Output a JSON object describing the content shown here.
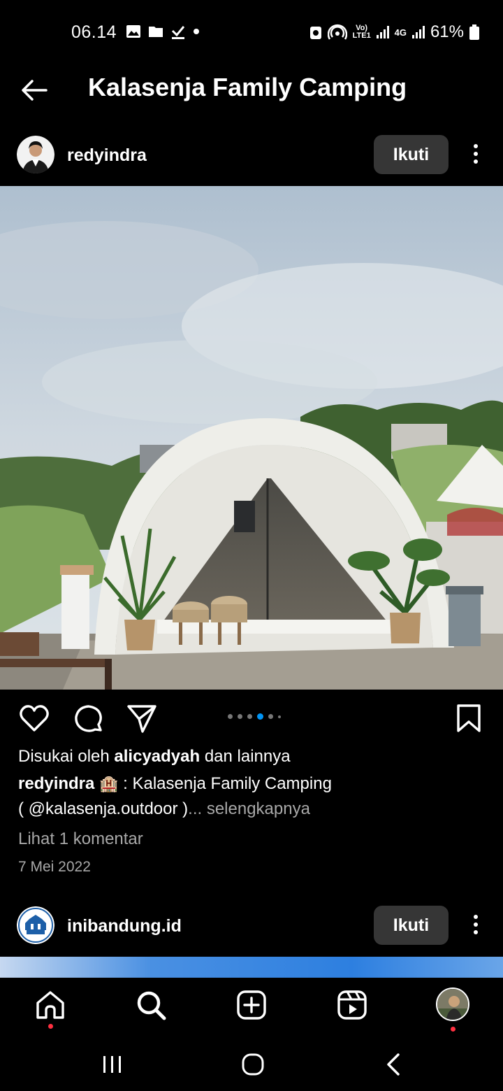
{
  "status": {
    "time": "06.14",
    "battery": "61%",
    "net1": "Vo) LTE1",
    "net2": "4G"
  },
  "header": {
    "title": "Kalasenja Family Camping"
  },
  "post1": {
    "username": "redyindra",
    "follow_label": "Ikuti",
    "carousel": {
      "count": 6,
      "active_index": 3
    },
    "likes_prefix": "Disukai oleh ",
    "likes_user": "alicyadyah",
    "likes_suffix": " dan lainnya",
    "caption_user": "redyindra",
    "caption_emoji": "🏨",
    "caption_text": " : Kalasenja Family Camping",
    "caption_line2": "( @kalasenja.outdoor )",
    "caption_more": "... selengkapnya",
    "comments": "Lihat 1 komentar",
    "date": "7 Mei 2022"
  },
  "post2": {
    "username": "inibandung.id",
    "follow_label": "Ikuti"
  },
  "colors": {
    "background": "#000000",
    "button_bg": "#363636",
    "active_dot": "#0095f6",
    "notification": "#ff3040"
  }
}
